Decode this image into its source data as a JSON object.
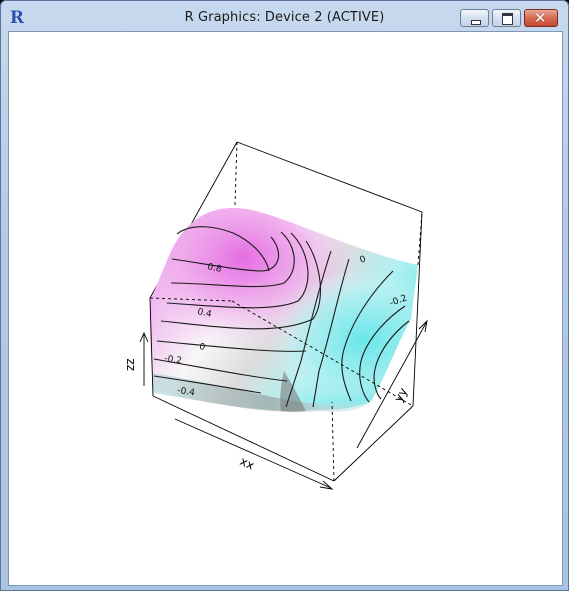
{
  "window": {
    "title": "R Graphics: Device 2 (ACTIVE)",
    "app_icon_letter": "R",
    "controls": {
      "minimize": "minimize-icon",
      "maximize": "maximize-icon",
      "close": "close-icon"
    }
  },
  "plot": {
    "axes": {
      "x_label": "xx",
      "y_label": "yy",
      "z_label": "zz"
    },
    "contour_labels": [
      "0.8",
      "0.4",
      "0",
      "-0.2",
      "-0.4",
      "0",
      "-0.2"
    ],
    "colors": {
      "high": "#e070e0",
      "mid": "#f4f4f4",
      "low": "#70e8ec",
      "shadow": "#7d7d7d"
    }
  }
}
